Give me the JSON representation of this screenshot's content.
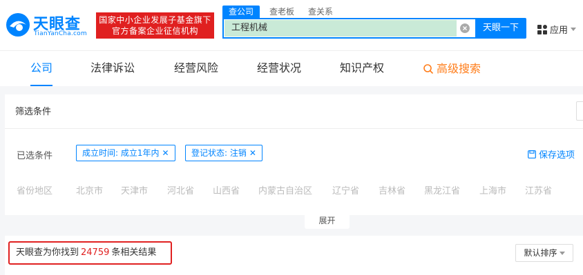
{
  "header": {
    "logo_text": "天眼查",
    "logo_domain": "TianYanCha.com",
    "promo_line1": "国家中小企业发展子基金旗下",
    "promo_line2": "官方备案企业征信机构",
    "search_tabs": [
      "查公司",
      "查老板",
      "查关系"
    ],
    "search_value": "工程机械",
    "search_button": "天眼一下",
    "apps_label": "应用"
  },
  "nav": {
    "items": [
      "公司",
      "法律诉讼",
      "经营风险",
      "经营状况",
      "知识产权"
    ],
    "advanced": "高级搜索"
  },
  "filter": {
    "title": "筛选条件",
    "selected_label": "已选条件",
    "chips": [
      "成立时间: 成立1年内",
      "登记状态: 注销"
    ],
    "save_label": "保存选项",
    "province_label": "省份地区",
    "provinces": [
      "北京市",
      "天津市",
      "河北省",
      "山西省",
      "内蒙古自治区",
      "辽宁省",
      "吉林省",
      "黑龙江省",
      "上海市",
      "江苏省"
    ],
    "expand_label": "展开"
  },
  "results": {
    "prefix": "天眼查为你找到",
    "count": "24759",
    "suffix": "条相关结果",
    "sort_label": "默认排序"
  },
  "colors": {
    "brand_blue": "#0084ff",
    "promo_red": "#e02020",
    "advanced_orange": "#ff7d1a",
    "search_highlight": "#c9ead7"
  }
}
